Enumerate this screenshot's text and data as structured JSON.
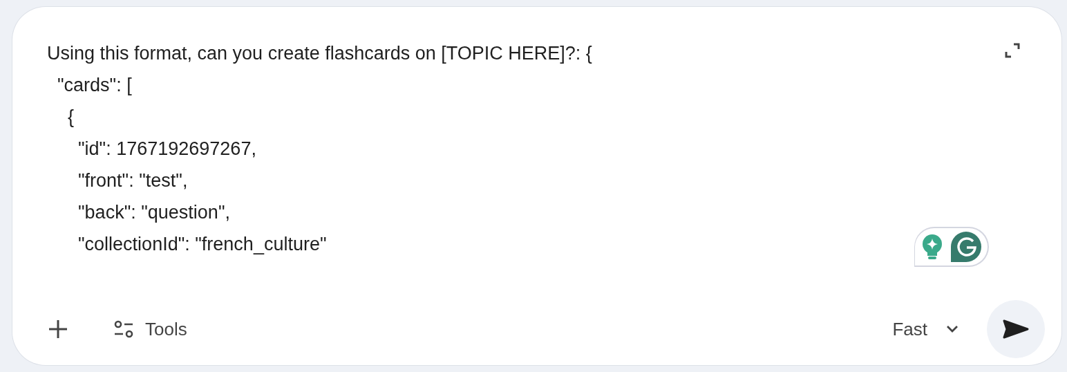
{
  "prompt": {
    "lines": [
      "Using this format, can you create flashcards on [TOPIC HERE]?: {",
      "  \"cards\": [",
      "    {",
      "      \"id\": 1767192697267,",
      "      \"front\": \"test\",",
      "      \"back\": \"question\",",
      "      \"collectionId\": \"french_culture\""
    ]
  },
  "toolbar": {
    "tools_label": "Tools",
    "model_label": "Fast"
  }
}
